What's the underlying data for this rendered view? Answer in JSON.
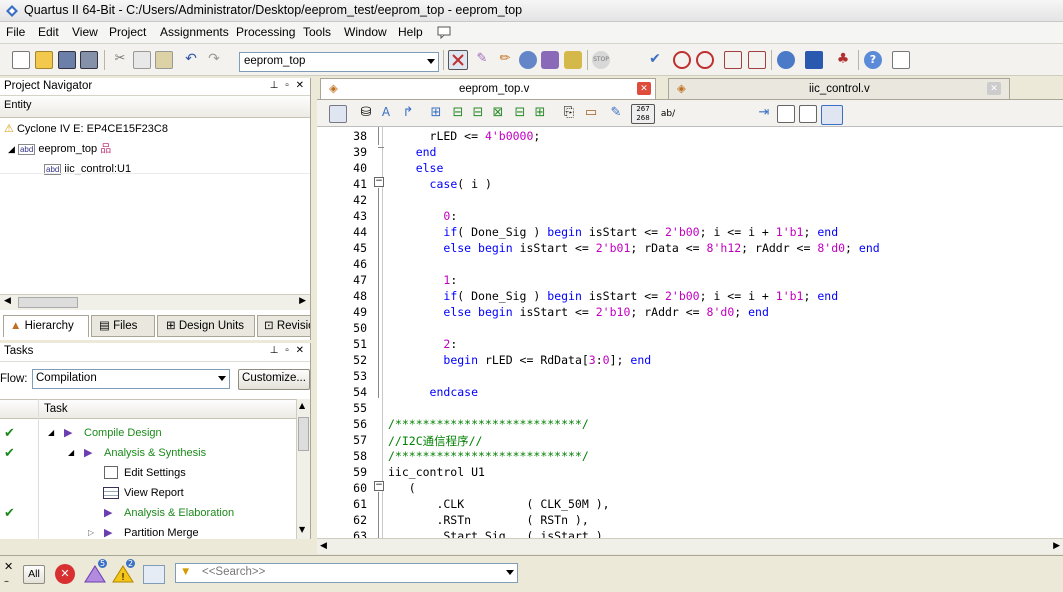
{
  "window": {
    "title": "Quartus II 64-Bit - C:/Users/Administrator/Desktop/eeprom_test/eeprom_top - eeprom_top"
  },
  "menu": [
    "File",
    "Edit",
    "View",
    "Project",
    "Assignments",
    "Processing",
    "Tools",
    "Window",
    "Help"
  ],
  "toolbar": {
    "entity": "eeprom_top",
    "highlighted_button": "start-compilation"
  },
  "project_navigator": {
    "title": "Project Navigator",
    "column": "Entity",
    "device": "Cyclone IV E: EP4CE15F23C8",
    "top": "eeprom_top",
    "child": "iic_control:U1",
    "tabs": [
      "Hierarchy",
      "Files",
      "Design Units",
      "Revisions"
    ]
  },
  "tasks": {
    "title": "Tasks",
    "flow_label": "Flow:",
    "flow_value": "Compilation",
    "customize": "Customize...",
    "column": "Task",
    "rows": [
      {
        "label": "Compile Design",
        "done": true,
        "level": 1
      },
      {
        "label": "Analysis & Synthesis",
        "done": true,
        "level": 2
      },
      {
        "label": "Edit Settings",
        "done": false,
        "level": 3
      },
      {
        "label": "View Report",
        "done": false,
        "level": 3
      },
      {
        "label": "Analysis & Elaboration",
        "done": true,
        "level": 3
      },
      {
        "label": "Partition Merge",
        "done": false,
        "level": 3
      }
    ]
  },
  "editor": {
    "tabs": [
      {
        "label": "eeprom_top.v",
        "active": true
      },
      {
        "label": "iic_control.v",
        "active": false
      }
    ],
    "lines": [
      {
        "n": "38",
        "t": "      rLED <= 4'b0000;"
      },
      {
        "n": "39",
        "t": "    end"
      },
      {
        "n": "40",
        "t": "    else"
      },
      {
        "n": "41",
        "t": "      case( i )"
      },
      {
        "n": "42",
        "t": ""
      },
      {
        "n": "43",
        "t": "        0:"
      },
      {
        "n": "44",
        "t": "        if( Done_Sig ) begin isStart <= 2'b00; i <= i + 1'b1; end"
      },
      {
        "n": "45",
        "t": "        else begin isStart <= 2'b01; rData <= 8'h12; rAddr <= 8'd0; end"
      },
      {
        "n": "46",
        "t": ""
      },
      {
        "n": "47",
        "t": "        1:"
      },
      {
        "n": "48",
        "t": "        if( Done_Sig ) begin isStart <= 2'b00; i <= i + 1'b1; end"
      },
      {
        "n": "49",
        "t": "        else begin isStart <= 2'b10; rAddr <= 8'd0; end"
      },
      {
        "n": "50",
        "t": ""
      },
      {
        "n": "51",
        "t": "        2:"
      },
      {
        "n": "52",
        "t": "        begin rLED <= RdData[3:0]; end"
      },
      {
        "n": "53",
        "t": ""
      },
      {
        "n": "54",
        "t": "      endcase"
      },
      {
        "n": "55",
        "t": ""
      },
      {
        "n": "56",
        "t": "/***************************/"
      },
      {
        "n": "57",
        "t": "//I2C通信程序//"
      },
      {
        "n": "58",
        "t": "/***************************/"
      },
      {
        "n": "59",
        "t": "iic_control U1"
      },
      {
        "n": "60",
        "t": "   ("
      },
      {
        "n": "61",
        "t": "       .CLK         ( CLK_50M ),"
      },
      {
        "n": "62",
        "t": "       .RSTn        ( RSTn ),"
      },
      {
        "n": "63",
        "t": "       .Start_Sig   ( isStart ),"
      }
    ]
  },
  "messages": {
    "all_label": "All",
    "critical_count": "5",
    "warning_count": "2",
    "search_placeholder": "<<Search>>"
  }
}
